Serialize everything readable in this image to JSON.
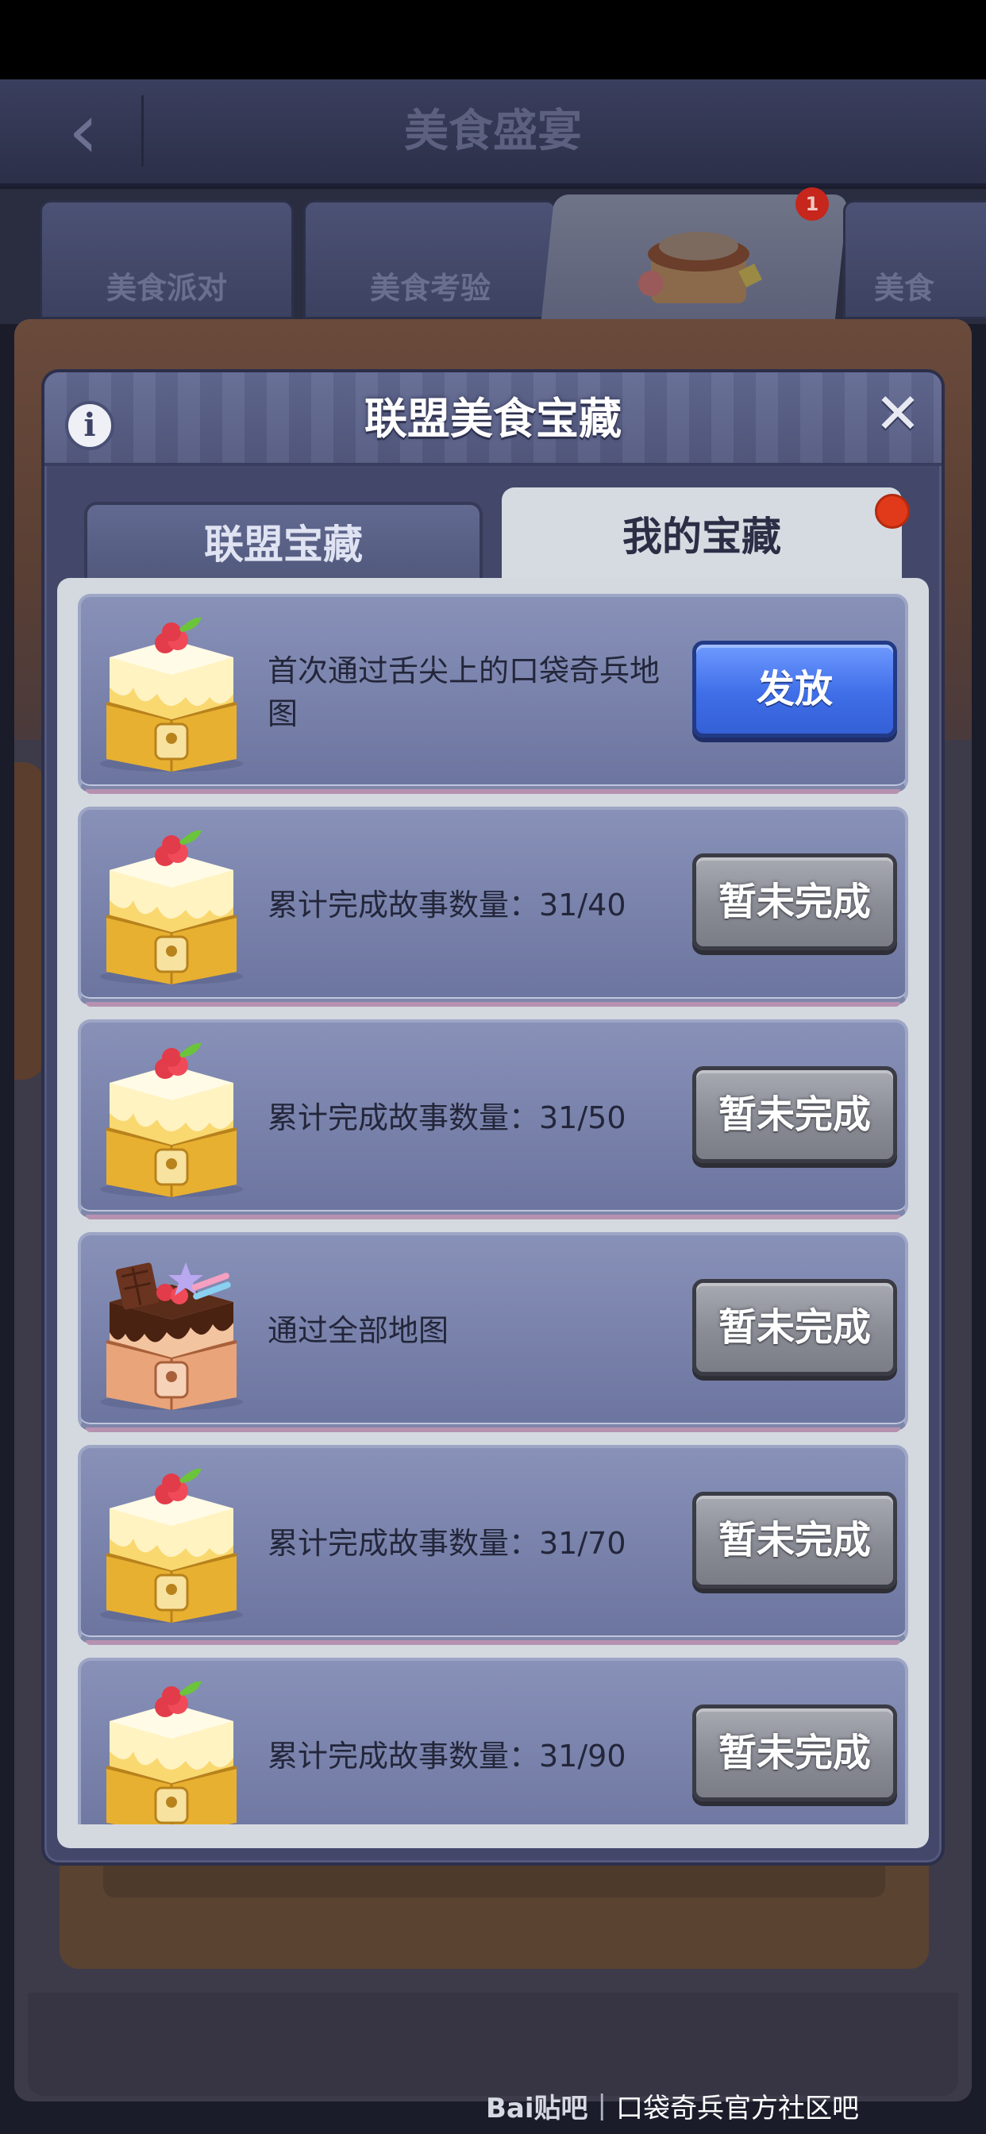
{
  "background": {
    "title": "美食盛宴",
    "tabs": [
      "美食派对",
      "美食考验",
      "美食"
    ],
    "tab_badge": "1"
  },
  "modal": {
    "title": "联盟美食宝藏",
    "info_icon": "i",
    "close_icon": "✕",
    "tabs": [
      {
        "label": "联盟宝藏",
        "active": false
      },
      {
        "label": "我的宝藏",
        "active": true
      }
    ],
    "rewards": [
      {
        "chest": "cake-chest-icon",
        "description": "首次通过舌尖上的口袋奇兵地图",
        "button": "发放",
        "state": "claimable"
      },
      {
        "chest": "cake-chest-icon",
        "description": "累计完成故事数量：31/40",
        "button": "暂未完成",
        "state": "incomplete"
      },
      {
        "chest": "cake-chest-icon",
        "description": "累计完成故事数量：31/50",
        "button": "暂未完成",
        "state": "incomplete"
      },
      {
        "chest": "chocolate-cake-chest-icon",
        "description": "通过全部地图",
        "button": "暂未完成",
        "state": "incomplete"
      },
      {
        "chest": "cake-chest-icon",
        "description": "累计完成故事数量：31/70",
        "button": "暂未完成",
        "state": "incomplete"
      },
      {
        "chest": "cake-chest-icon",
        "description": "累计完成故事数量：31/90",
        "button": "暂未完成",
        "state": "incomplete"
      }
    ]
  },
  "watermark": {
    "logo": "Bai贴吧",
    "text": "口袋奇兵官方社区吧"
  },
  "colors": {
    "claim_button": "#3f6ee8",
    "pending_button": "#8a8c95",
    "notification_dot": "#e03a1a"
  }
}
